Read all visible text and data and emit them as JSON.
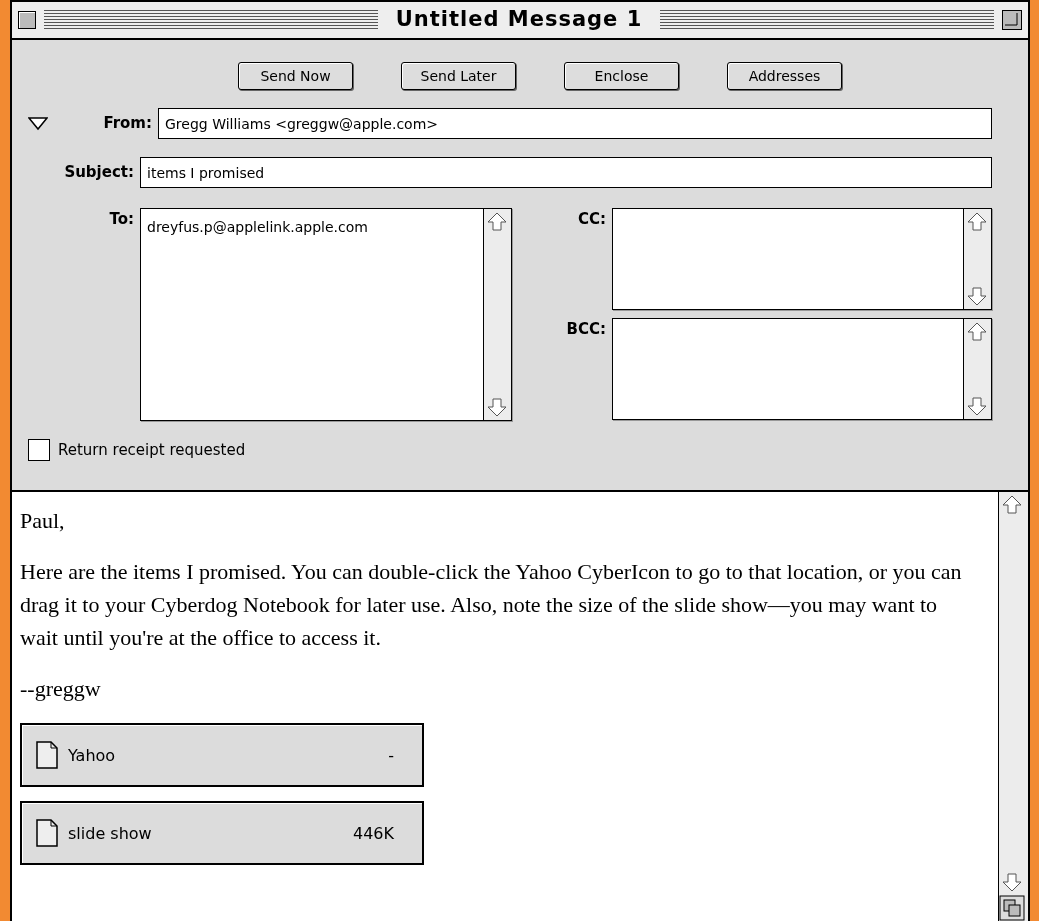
{
  "window": {
    "title": "Untitled Message 1"
  },
  "toolbar": {
    "buttons": [
      "Send Now",
      "Send Later",
      "Enclose",
      "Addresses"
    ]
  },
  "header": {
    "expanded": true,
    "from": {
      "label": "From:",
      "value": "Gregg Williams <greggw@apple.com>"
    },
    "subject": {
      "label": "Subject:",
      "value": "items I promised"
    },
    "to": {
      "label": "To:",
      "value": "dreyfus.p@applelink.apple.com"
    },
    "cc": {
      "label": "CC:"
    },
    "bcc": {
      "label": "BCC:"
    },
    "return_receipt": {
      "label": "Return receipt requested",
      "checked": false
    }
  },
  "body": {
    "paragraphs": [
      "Paul,",
      "Here are the items I promised. You can double-click the Yahoo CyberIcon to go to that location, or you can drag it to your Cyberdog Notebook for later use. Also, note the size of the slide show—you may want to wait until you're at the office to access it.",
      "--greggw"
    ],
    "enclosures": [
      {
        "name": "Yahoo",
        "size": "-"
      },
      {
        "name": "slide show",
        "size": "446K"
      }
    ]
  }
}
